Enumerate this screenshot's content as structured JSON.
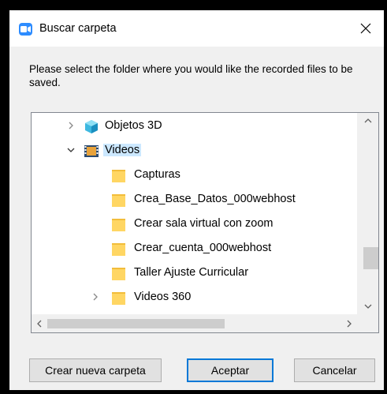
{
  "dialog": {
    "title": "Buscar carpeta",
    "prompt": "Please select the folder where you would like the recorded files to be saved."
  },
  "tree": {
    "items": [
      {
        "label": "Objetos 3D",
        "icon": "3d-objects-icon",
        "expander": "collapsed"
      },
      {
        "label": "Videos",
        "icon": "videos-folder-icon",
        "expander": "expanded",
        "selected": true
      },
      {
        "label": "Capturas",
        "icon": "folder-icon"
      },
      {
        "label": "Crea_Base_Datos_000webhost",
        "icon": "folder-icon"
      },
      {
        "label": "Crear sala virtual con zoom",
        "icon": "folder-icon"
      },
      {
        "label": "Crear_cuenta_000webhost",
        "icon": "folder-icon"
      },
      {
        "label": "Taller Ajuste Curricular",
        "icon": "folder-icon"
      },
      {
        "label": "Videos 360",
        "icon": "folder-icon",
        "expander": "collapsed"
      }
    ]
  },
  "buttons": {
    "new_folder": "Crear nueva carpeta",
    "ok": "Aceptar",
    "cancel": "Cancelar"
  },
  "colors": {
    "accent": "#0078d7",
    "selection": "#cce8ff",
    "app_icon": "#2d8cff",
    "folder": "#ffd663"
  }
}
